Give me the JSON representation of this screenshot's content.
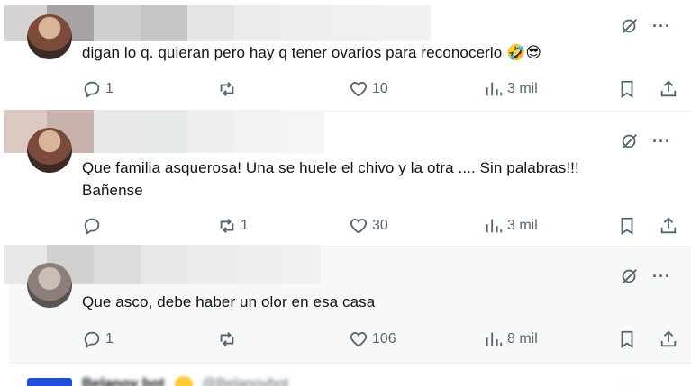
{
  "posts": [
    {
      "text": "digan lo q. quieran pero hay q tener ovarios para reconocerlo 🤣😎",
      "reply_count": "1",
      "repost_count": "",
      "like_count": "10",
      "view_count": "3 mil"
    },
    {
      "text_line1": "Que familia asquerosa!  Una se huele el chivo y la otra .... Sin palabras!!!",
      "text_line2": "Bañense",
      "reply_count": "",
      "repost_count": "1",
      "like_count": "30",
      "view_count": "3 mil"
    },
    {
      "text": "Que asco, debe haber un olor en esa casa",
      "reply_count": "1",
      "repost_count": "",
      "like_count": "106",
      "view_count": "8 mil"
    }
  ],
  "next_post": {
    "name": "Belanov bot",
    "handle": "@Belanovbot",
    "more": "· · ·"
  },
  "icons": {
    "grok": "grok-icon",
    "more": "more-icon",
    "reply": "reply-icon",
    "repost": "repost-icon",
    "like": "heart-icon",
    "views": "views-icon",
    "bookmark": "bookmark-icon",
    "share": "share-icon"
  },
  "colors": {
    "icon_gray": "#536471",
    "text": "#0f1419",
    "hover_bg": "#f7f9f9",
    "divider": "#eff3f4"
  },
  "more_glyph": "···"
}
